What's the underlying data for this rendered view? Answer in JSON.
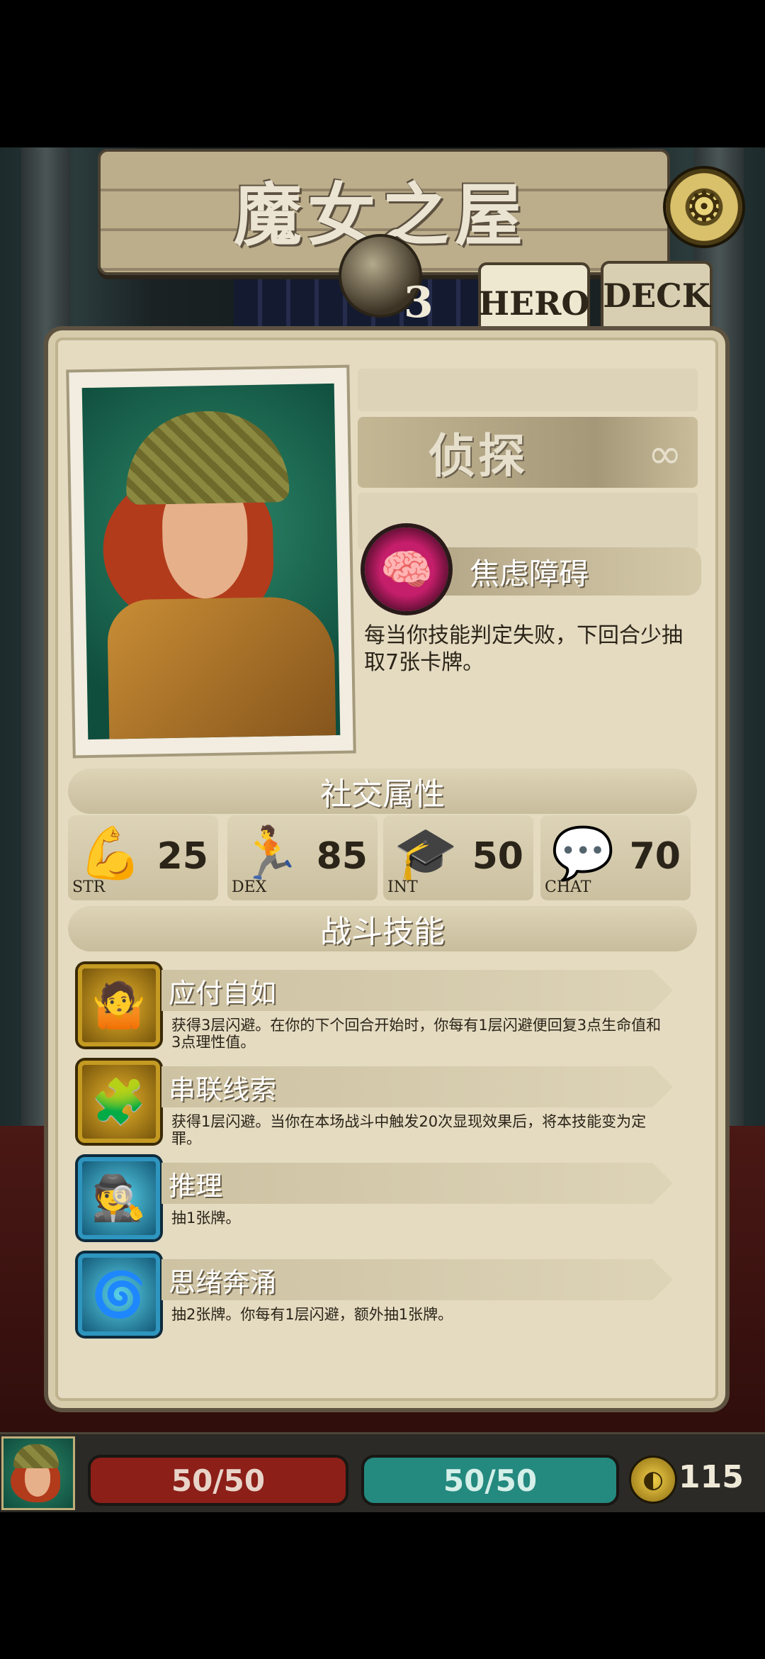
{
  "header": {
    "title": "魔女之屋",
    "level": "3",
    "tabs": [
      {
        "label": "HERO",
        "active": true
      },
      {
        "label": "DECK",
        "active": false
      }
    ],
    "settings_icon": "gear-icon"
  },
  "hero": {
    "class_name": "侦探",
    "trait": {
      "name": "焦虑障碍",
      "icon": "anxiety-brain-icon",
      "description": "每当你技能判定失败，下回合少抽取7张卡牌。"
    }
  },
  "social_section": {
    "title": "社交属性",
    "stats": [
      {
        "label": "STR",
        "value": "25",
        "icon": "strength-icon"
      },
      {
        "label": "DEX",
        "value": "85",
        "icon": "dexterity-icon"
      },
      {
        "label": "INT",
        "value": "50",
        "icon": "intelligence-icon"
      },
      {
        "label": "CHAT",
        "value": "70",
        "icon": "chat-icon"
      }
    ]
  },
  "combat_section": {
    "title": "战斗技能",
    "skills": [
      {
        "name": "应付自如",
        "description": "获得3层闪避。在你的下个回合开始时，你每有1层闪避便回复3点生命值和3点理性值。",
        "icon": "shrug-icon",
        "style": "gold"
      },
      {
        "name": "串联线索",
        "description": "获得1层闪避。当你在本场战斗中触发20次显现效果后，将本技能变为定罪。",
        "icon": "clue-board-icon",
        "style": "gold"
      },
      {
        "name": "推理",
        "description": "抽1张牌。",
        "icon": "detective-silhouette-icon",
        "style": "blue"
      },
      {
        "name": "思绪奔涌",
        "description": "抽2张牌。你每有1层闪避，额外抽1张牌。",
        "icon": "thought-rush-icon",
        "style": "blue"
      }
    ]
  },
  "status_bar": {
    "hp": "50/50",
    "sanity": "50/50",
    "gold": "115",
    "hp_color": "#8c1f18",
    "sanity_color": "#24897f"
  }
}
